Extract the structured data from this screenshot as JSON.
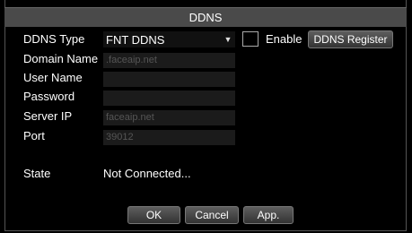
{
  "dialog": {
    "title": "DDNS"
  },
  "form": {
    "ddns_type_label": "DDNS Type",
    "ddns_type_value": "FNT DDNS",
    "enable_label": "Enable",
    "register_button": "DDNS Register",
    "domain_label": "Domain Name",
    "domain_value": ".faceaip.net",
    "user_label": "User Name",
    "user_value": "",
    "password_label": "Password",
    "password_value": "",
    "server_label": "Server IP",
    "server_value": "faceaip.net",
    "port_label": "Port",
    "port_value": "39012",
    "state_label": "State",
    "state_value": "Not Connected..."
  },
  "buttons": {
    "ok": "OK",
    "cancel": "Cancel",
    "apply": "App."
  },
  "icons": {
    "dropdown": "chevron-down-icon"
  },
  "colors": {
    "background": "#000000",
    "titlebar": "#4a4a4a",
    "field": "#1b1b1b",
    "text": "#ffffff",
    "placeholder_text": "#555555"
  }
}
